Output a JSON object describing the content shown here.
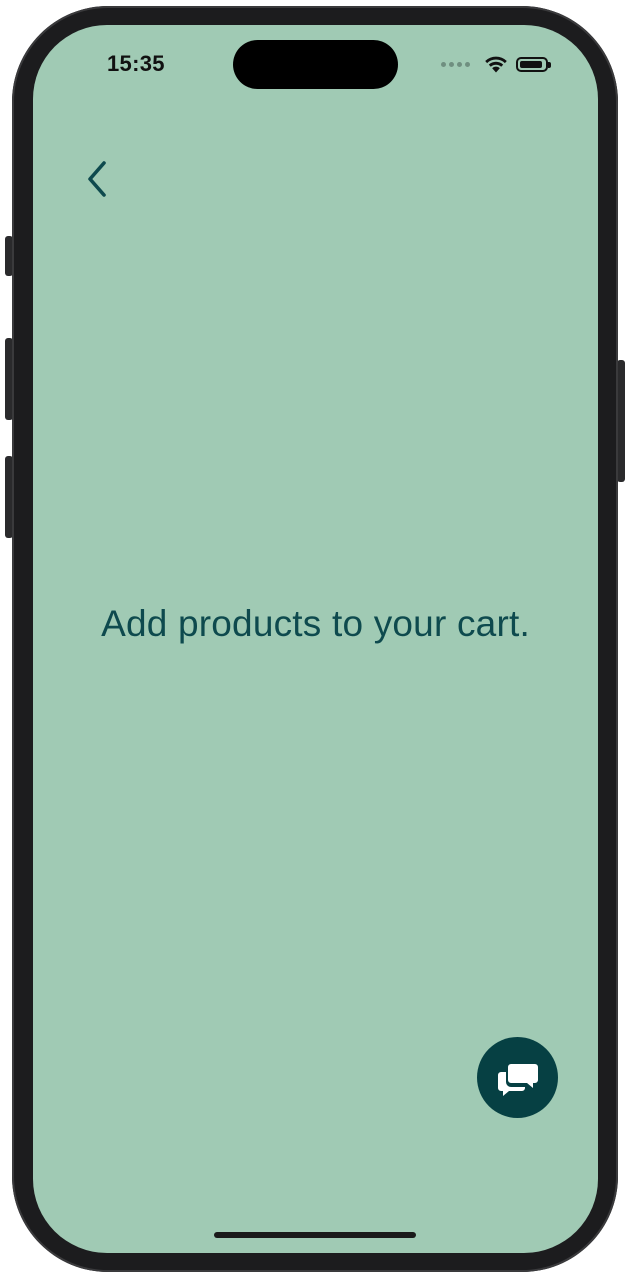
{
  "status_bar": {
    "time": "15:35",
    "icons": [
      "signal-dots-icon",
      "wifi-icon",
      "battery-icon"
    ]
  },
  "nav": {
    "back_icon": "chevron-left-icon"
  },
  "cart": {
    "empty_message": "Add products to your cart."
  },
  "chat_button": {
    "icon": "chat-bubbles-icon"
  },
  "colors": {
    "background": "#a0cab4",
    "text": "#0e4a4e",
    "accent": "#064043"
  }
}
